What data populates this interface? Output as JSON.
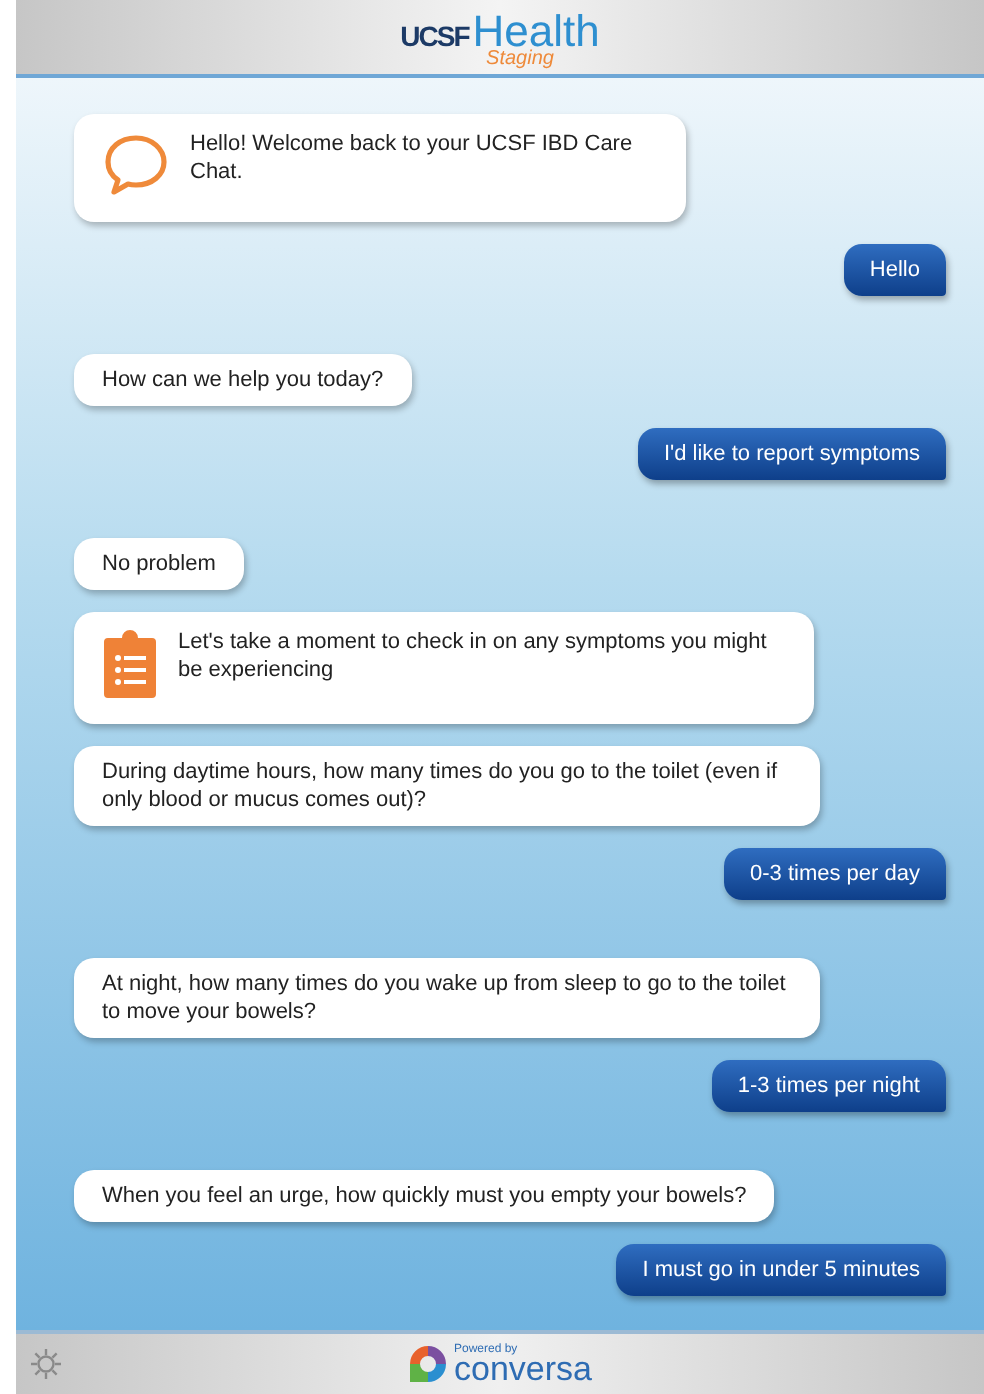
{
  "header": {
    "logo_mark": "UCSF",
    "logo_word": "Health",
    "environment": "Staging"
  },
  "messages": [
    {
      "kind": "welcome",
      "text": "Hello! Welcome back to your UCSF IBD Care Chat."
    },
    {
      "kind": "user",
      "text": "Hello"
    },
    {
      "kind": "bot",
      "text": "How can we help you today?"
    },
    {
      "kind": "user",
      "text": "I'd like to report symptoms"
    },
    {
      "kind": "bot",
      "text": "No problem"
    },
    {
      "kind": "checkin",
      "text": "Let's take a moment to check in on any symptoms you might be experiencing"
    },
    {
      "kind": "bot",
      "text": "During daytime hours, how many times do you go to the toilet (even if only blood or mucus comes out)?"
    },
    {
      "kind": "user",
      "text": "0-3 times per day"
    },
    {
      "kind": "bot",
      "text": "At night, how many times do you wake up from sleep to go to the toilet to move your bowels?"
    },
    {
      "kind": "user",
      "text": "1-3 times per night"
    },
    {
      "kind": "bot",
      "text": "When you feel an urge, how quickly must you empty your bowels?"
    },
    {
      "kind": "user",
      "text": "I must go in under 5 minutes"
    }
  ],
  "footer": {
    "powered_by": "Powered by",
    "brand": "conversa"
  }
}
